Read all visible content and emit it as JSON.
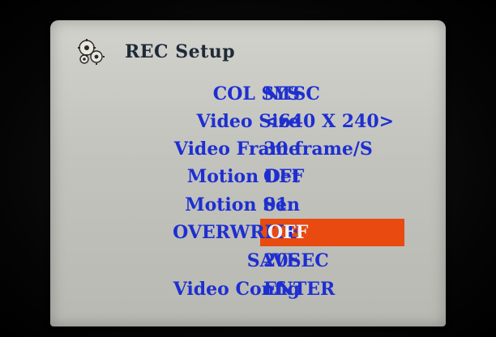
{
  "menu": {
    "title": "REC Setup",
    "icon": "gears-icon",
    "text_color": "#1e2fd0",
    "highlight_color": "#e84a10",
    "selected_index": 5,
    "items": [
      {
        "label": "COL SYS",
        "value": "NTSC"
      },
      {
        "label": "Video Size",
        "value": "<640 X 240>"
      },
      {
        "label": "Video Frame",
        "value": "30 frame/S"
      },
      {
        "label": "Motion Det",
        "value": "OFF"
      },
      {
        "label": "Motion Sen",
        "value": "01"
      },
      {
        "label": "OVERWRITE",
        "value": "OFF"
      },
      {
        "label": "SAVE",
        "value": "20SEC"
      },
      {
        "label": "Video Config",
        "value": "ENTER"
      }
    ]
  }
}
